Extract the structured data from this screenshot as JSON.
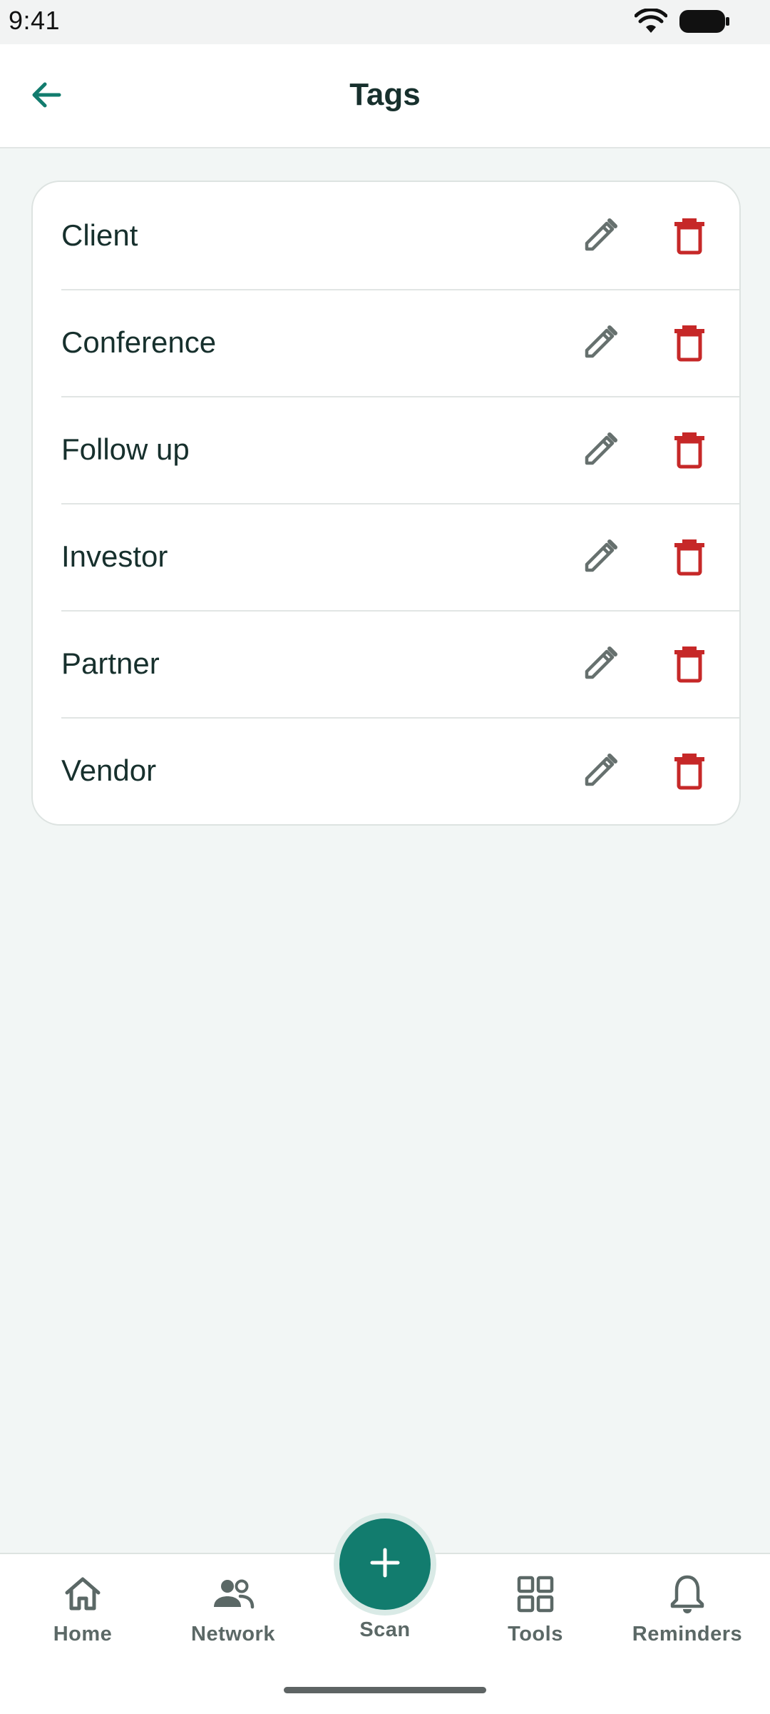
{
  "status_bar": {
    "time": "9:41",
    "icons": [
      "wifi-icon",
      "battery-icon"
    ]
  },
  "header": {
    "title": "Tags",
    "back_icon": "arrow-left-icon"
  },
  "tags": [
    {
      "label": "Client"
    },
    {
      "label": "Conference"
    },
    {
      "label": "Follow up"
    },
    {
      "label": "Investor"
    },
    {
      "label": "Partner"
    },
    {
      "label": "Vendor"
    }
  ],
  "row_actions": {
    "edit_icon": "pencil-icon",
    "delete_icon": "trash-icon"
  },
  "colors": {
    "accent": "#127C6E",
    "delete": "#C62828",
    "edit": "#66706E",
    "background": "#F2F6F5",
    "nav_text": "#5B6866"
  },
  "bottom_nav": {
    "items": [
      {
        "label": "Home",
        "icon": "home-icon"
      },
      {
        "label": "Network",
        "icon": "people-icon"
      },
      {
        "label": "Scan",
        "icon": "plus-icon"
      },
      {
        "label": "Tools",
        "icon": "grid-icon"
      },
      {
        "label": "Reminders",
        "icon": "bell-icon"
      }
    ]
  }
}
